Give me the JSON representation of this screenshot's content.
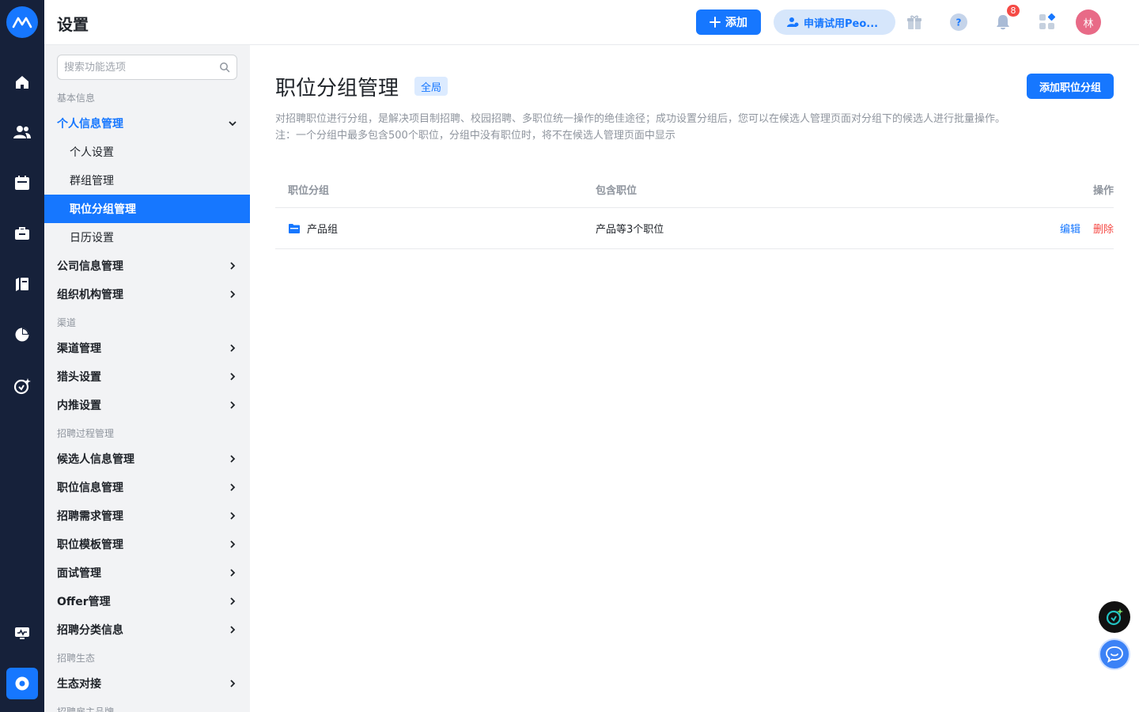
{
  "header": {
    "title": "设置",
    "add_label": "添加",
    "trial_label": "申请试用Peo...",
    "notification_count": "8",
    "avatar_text": "林"
  },
  "sidebar": {
    "search_placeholder": "搜索功能选项",
    "groups": {
      "basic": "基本信息",
      "channel": "渠道",
      "process": "招聘过程管理",
      "ecosystem": "招聘生态",
      "employer": "招聘雇主品牌"
    },
    "items": {
      "personal_info": "个人信息管理",
      "personal_settings": "个人设置",
      "group_mgmt": "群组管理",
      "position_group_mgmt": "职位分组管理",
      "calendar_settings": "日历设置",
      "company_info": "公司信息管理",
      "org_mgmt": "组织机构管理",
      "channel_mgmt": "渠道管理",
      "headhunter_settings": "猎头设置",
      "referral_settings": "内推设置",
      "candidate_info": "候选人信息管理",
      "position_info": "职位信息管理",
      "requirement_mgmt": "招聘需求管理",
      "position_template": "职位模板管理",
      "interview_mgmt": "面试管理",
      "offer_mgmt": "Offer管理",
      "category_info": "招聘分类信息",
      "ecosystem_integration": "生态对接"
    }
  },
  "main": {
    "title": "职位分组管理",
    "scope_tag": "全局",
    "add_button": "添加职位分组",
    "description_1": "对招聘职位进行分组，是解决项目制招聘、校园招聘、多职位统一操作的绝佳途径；成功设置分组后，您可以在候选人管理页面对分组下的候选人进行批量操作。",
    "description_2": "注：一个分组中最多包含500个职位，分组中没有职位时，将不在候选人管理页面中显示",
    "table": {
      "headers": [
        "职位分组",
        "包含职位",
        "操作"
      ],
      "rows": [
        {
          "group": "产品组",
          "positions": "产品等3个职位",
          "edit": "编辑",
          "delete": "删除"
        }
      ]
    }
  },
  "colors": {
    "primary": "#1677ff",
    "rail_bg": "#16213a",
    "sidebar_bg": "#f2f3f5",
    "danger": "#f54a45",
    "avatar_bg": "#e86a87"
  }
}
